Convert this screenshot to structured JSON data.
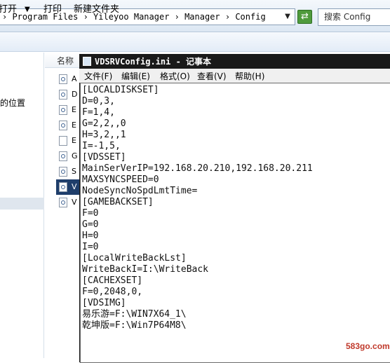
{
  "explorer": {
    "address_path": "› Program Files › Yileyoo Manager › Manager › Config",
    "search_placeholder": "搜索 Config",
    "toolbar": {
      "open_label": "打开",
      "open_dropdown": "▼",
      "print_label": "打印",
      "new_folder_label": "新建文件夹"
    },
    "nav_pane_text": "的位置",
    "column_header_name": "名称",
    "files": [
      {
        "letter": "A",
        "icon": "gear-file-icon",
        "selected": false
      },
      {
        "letter": "D",
        "icon": "gear-file-icon",
        "selected": false
      },
      {
        "letter": "E",
        "icon": "gear-file-icon",
        "selected": false
      },
      {
        "letter": "E",
        "icon": "gear-file-icon",
        "selected": false
      },
      {
        "letter": "E",
        "icon": "blank-file-icon",
        "selected": false
      },
      {
        "letter": "G",
        "icon": "gear-file-icon",
        "selected": false
      },
      {
        "letter": "S",
        "icon": "gear-file-icon",
        "selected": false
      },
      {
        "letter": "V",
        "icon": "gear-file-icon",
        "selected": true
      },
      {
        "letter": "V",
        "icon": "gear-file-icon",
        "selected": false
      }
    ]
  },
  "notepad": {
    "title": "VDSRVConfig.ini - 记事本",
    "menu": [
      "文件(F)",
      "编辑(E)",
      "格式(O)",
      "查看(V)",
      "帮助(H)"
    ],
    "lines": [
      "[LOCALDISKSET]",
      "D=0,3,",
      "F=1,4,",
      "G=2,2,,0",
      "H=3,2,,1",
      "I=-1,5,",
      "[VDSSET]",
      "MainSerVerIP=192.168.20.210,192.168.20.211",
      "MAXSYNCSPEED=0",
      "NodeSyncNoSpdLmtTime=",
      "[GAMEBACKSET]",
      "F=0",
      "G=0",
      "H=0",
      "I=0",
      "[LocalWriteBackLst]",
      "WriteBackI=I:\\WriteBack",
      "[CACHEXSET]",
      "F=0,2048,0,",
      "[VDSIMG]",
      "易乐游=F:\\WIN7X64_1\\",
      "乾坤版=F:\\Win7P64M8\\"
    ]
  },
  "watermark": "583go.com"
}
